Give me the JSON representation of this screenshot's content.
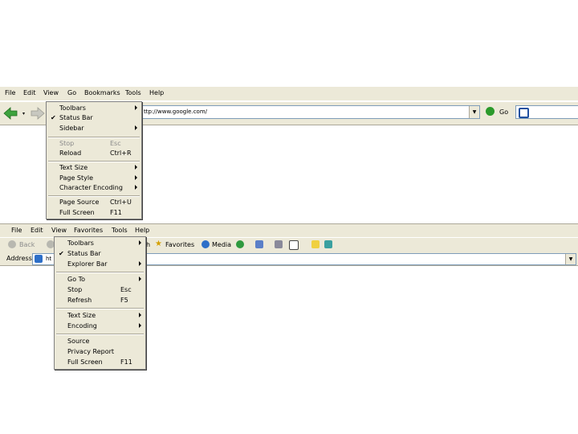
{
  "firefox": {
    "menubar": [
      "File",
      "Edit",
      "View",
      "Go",
      "Bookmarks",
      "Tools",
      "Help"
    ],
    "url": "ttp://www.google.com/",
    "go_label": "Go",
    "view_menu": {
      "items": [
        {
          "label": "Toolbars",
          "shortcut": "",
          "submenu": true
        },
        {
          "label": "Status Bar",
          "shortcut": "",
          "checked": true
        },
        {
          "label": "Sidebar",
          "shortcut": "",
          "submenu": true
        },
        {
          "label": "Stop",
          "shortcut": "Esc",
          "disabled": true
        },
        {
          "label": "Reload",
          "shortcut": "Ctrl+R"
        },
        {
          "label": "Text Size",
          "shortcut": "",
          "submenu": true
        },
        {
          "label": "Page Style",
          "shortcut": "",
          "submenu": true
        },
        {
          "label": "Character Encoding",
          "shortcut": "",
          "submenu": true
        },
        {
          "label": "Page Source",
          "shortcut": "Ctrl+U"
        },
        {
          "label": "Full Screen",
          "shortcut": "F11"
        }
      ]
    }
  },
  "ie": {
    "menubar": [
      "File",
      "Edit",
      "View",
      "Favorites",
      "Tools",
      "Help"
    ],
    "toolbar": {
      "back": "Back",
      "search": "h",
      "favorites": "Favorites",
      "media": "Media"
    },
    "address_label": "Address",
    "address_value": "ht",
    "view_menu": {
      "items": [
        {
          "label": "Toolbars",
          "shortcut": "",
          "submenu": true
        },
        {
          "label": "Status Bar",
          "shortcut": "",
          "checked": true
        },
        {
          "label": "Explorer Bar",
          "shortcut": "",
          "submenu": true
        },
        {
          "label": "Go To",
          "shortcut": "",
          "submenu": true
        },
        {
          "label": "Stop",
          "shortcut": "Esc"
        },
        {
          "label": "Refresh",
          "shortcut": "F5"
        },
        {
          "label": "Text Size",
          "shortcut": "",
          "submenu": true
        },
        {
          "label": "Encoding",
          "shortcut": "",
          "submenu": true
        },
        {
          "label": "Source",
          "shortcut": ""
        },
        {
          "label": "Privacy Report",
          "shortcut": ""
        },
        {
          "label": "Full Screen",
          "shortcut": "F11"
        }
      ]
    }
  },
  "colors": {
    "chrome": "#ece9d8",
    "ff_arrow": "#3ea33e",
    "go": "#2b9a2b"
  }
}
